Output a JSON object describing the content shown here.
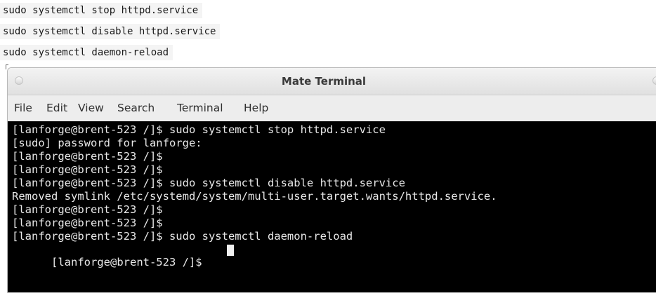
{
  "commands": [
    "sudo systemctl stop httpd.service",
    "sudo systemctl disable httpd.service",
    "sudo systemctl daemon-reload"
  ],
  "window": {
    "title": "Mate Terminal"
  },
  "menu": {
    "items": [
      "File",
      "Edit",
      "View",
      "Search",
      "Terminal",
      "Help"
    ]
  },
  "terminal": {
    "lines": [
      "[lanforge@brent-523 /]$ sudo systemctl stop httpd.service",
      "[sudo] password for lanforge:",
      "[lanforge@brent-523 /]$",
      "[lanforge@brent-523 /]$",
      "[lanforge@brent-523 /]$ sudo systemctl disable httpd.service",
      "Removed symlink /etc/systemd/system/multi-user.target.wants/httpd.service.",
      "[lanforge@brent-523 /]$",
      "[lanforge@brent-523 /]$",
      "[lanforge@brent-523 /]$ sudo systemctl daemon-reload",
      "[lanforge@brent-523 /]$ "
    ]
  },
  "colors": {
    "terminal_bg": "#000000",
    "terminal_fg": "#e8e8e8",
    "window_chrome": "#ededed",
    "code_bg": "#f4f4f4"
  },
  "icons": {
    "window_close": "window-close-icon",
    "window_button": "window-button-icon",
    "cursor": "text-cursor-icon"
  }
}
